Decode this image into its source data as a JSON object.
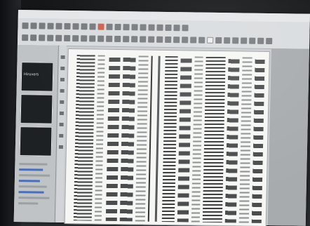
{
  "scene": {
    "description_free": true
  },
  "sidebar": {
    "thumbnail_label": "Hiruvers"
  },
  "colors": {
    "screen_bg": "#c9cdd0",
    "canvas_bg": "#f6f6f4",
    "toolbar_bg": "#d9dcde",
    "accent_red": "#c4452b"
  },
  "icons": {
    "toolbar": [
      "tool-icon",
      "tool-icon",
      "tool-icon",
      "tool-icon",
      "record-icon",
      "tool-icon",
      "tool-icon"
    ]
  }
}
